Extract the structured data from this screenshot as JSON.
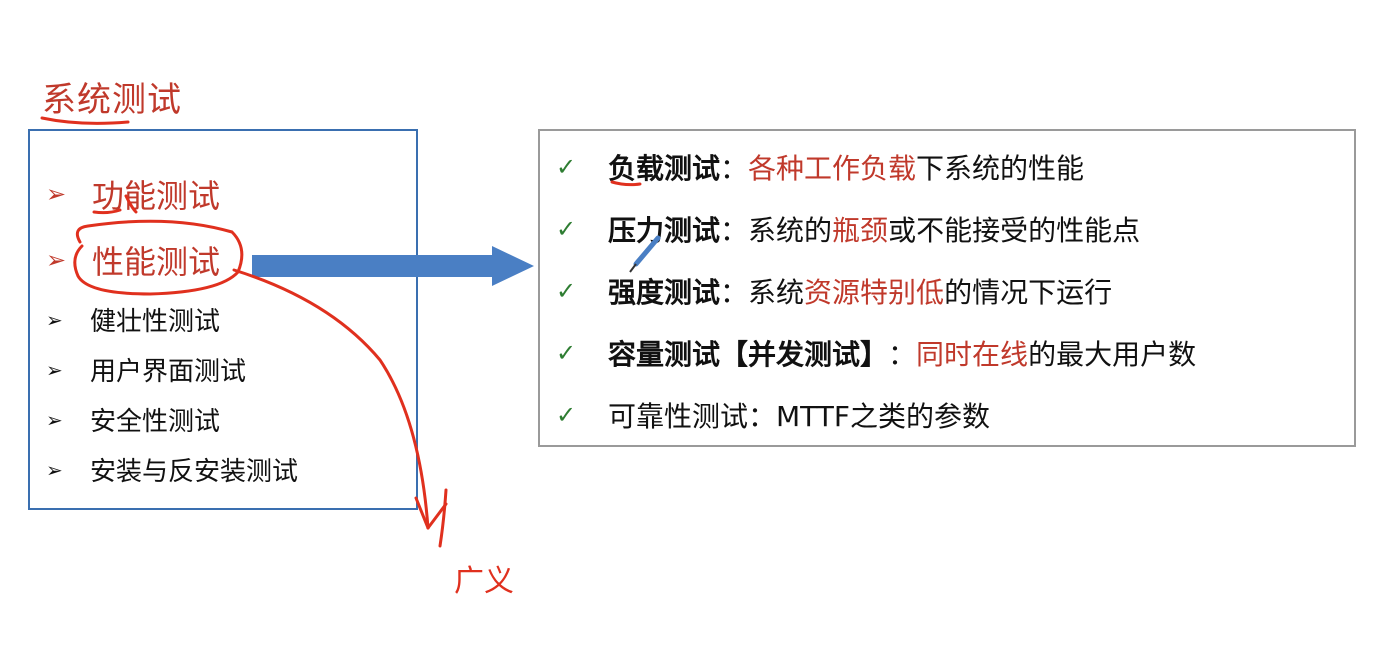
{
  "title": "系统测试",
  "left_list": [
    {
      "text": "功能测试"
    },
    {
      "text": "性能测试"
    },
    {
      "text": "健壮性测试"
    },
    {
      "text": "用户界面测试"
    },
    {
      "text": "安全性测试"
    },
    {
      "text": "安装与反安装测试"
    }
  ],
  "right_list": [
    {
      "term": "负载测试",
      "sep": "：",
      "red": "各种工作负载",
      "rest": "下系统的性能"
    },
    {
      "term": "压力测试",
      "sep": "：",
      "pre": "系统的",
      "red": "瓶颈",
      "rest": "或不能接受的性能点"
    },
    {
      "term": "强度测试",
      "sep": "：",
      "pre": "系统",
      "red": "资源特别低",
      "rest": "的情况下运行"
    },
    {
      "term": "容量测试",
      "bracket": "【并发测试】",
      "sep": "：",
      "red": "同时在线",
      "rest": "的最大用户数"
    },
    {
      "plain": "可靠性测试：MTTF之类的参数"
    }
  ],
  "annotation": "广义",
  "colors": {
    "accent_red": "#c0392b",
    "box_blue": "#3a6fb0",
    "arrow_blue": "#4a7fc4",
    "check_green": "#2e7d32",
    "pen_red": "#e0301e"
  },
  "icons": {
    "bullet": "arrowhead-icon",
    "check": "check-icon"
  }
}
